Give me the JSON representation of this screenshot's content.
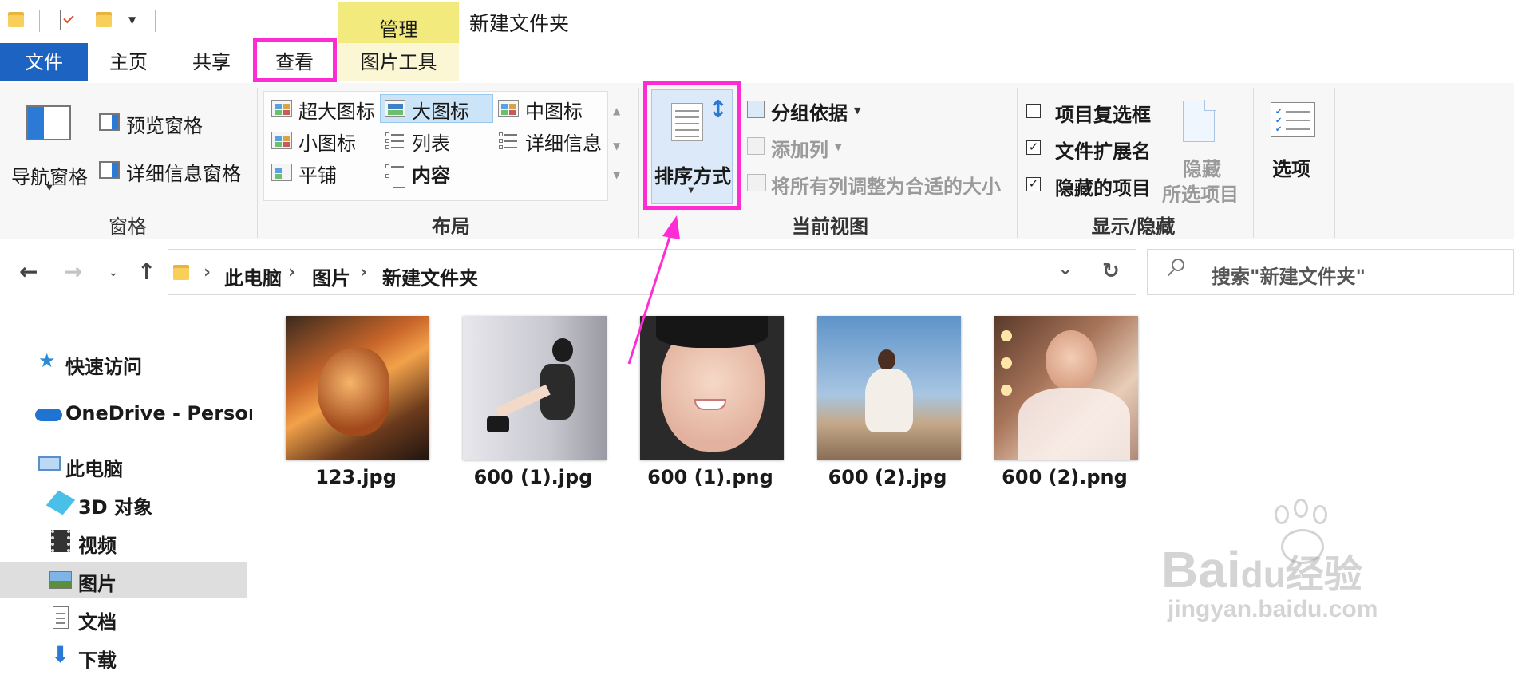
{
  "window": {
    "title": "新建文件夹",
    "contextual_tab_group": "管理"
  },
  "tabs": {
    "file": "文件",
    "home": "主页",
    "share": "共享",
    "view": "查看",
    "picture_tools": "图片工具"
  },
  "ribbon": {
    "panes": {
      "group_label": "窗格",
      "nav_pane": "导航窗格",
      "preview_pane": "预览窗格",
      "details_pane": "详细信息窗格"
    },
    "layout": {
      "group_label": "布局",
      "options": [
        "超大图标",
        "大图标",
        "中图标",
        "小图标",
        "列表",
        "详细信息",
        "平铺",
        "内容"
      ],
      "selected": "大图标"
    },
    "current_view": {
      "group_label": "当前视图",
      "sort_by": "排序方式",
      "group_by": "分组依据",
      "add_column": "添加列",
      "size_all_columns": "将所有列调整为合适的大小"
    },
    "show_hide": {
      "group_label": "显示/隐藏",
      "item_checkboxes": "项目复选框",
      "item_checkboxes_checked": false,
      "file_extensions": "文件扩展名",
      "file_extensions_checked": true,
      "hidden_items": "隐藏的项目",
      "hidden_items_checked": true,
      "hide_selected_line1": "隐藏",
      "hide_selected_line2": "所选项目"
    },
    "options": "选项"
  },
  "address": {
    "crumbs": [
      "此电脑",
      "图片",
      "新建文件夹"
    ],
    "search_placeholder": "搜索\"新建文件夹\""
  },
  "nav_pane": {
    "items": [
      "快速访问",
      "OneDrive - Persona",
      "此电脑",
      "3D 对象",
      "视频",
      "图片",
      "文档",
      "下载"
    ],
    "selected": "图片"
  },
  "files": [
    "123.jpg",
    "600 (1).jpg",
    "600 (1).png",
    "600 (2).jpg",
    "600 (2).png"
  ],
  "watermark": {
    "line1": "Bai",
    "line1b": "du",
    "line1c": "经验",
    "line2": "jingyan.baidu.com"
  },
  "colors": {
    "accent_blue": "#1d64c2",
    "highlight_magenta": "#ff2bd5",
    "manage_tab_yellow": "#f3ea7d"
  }
}
